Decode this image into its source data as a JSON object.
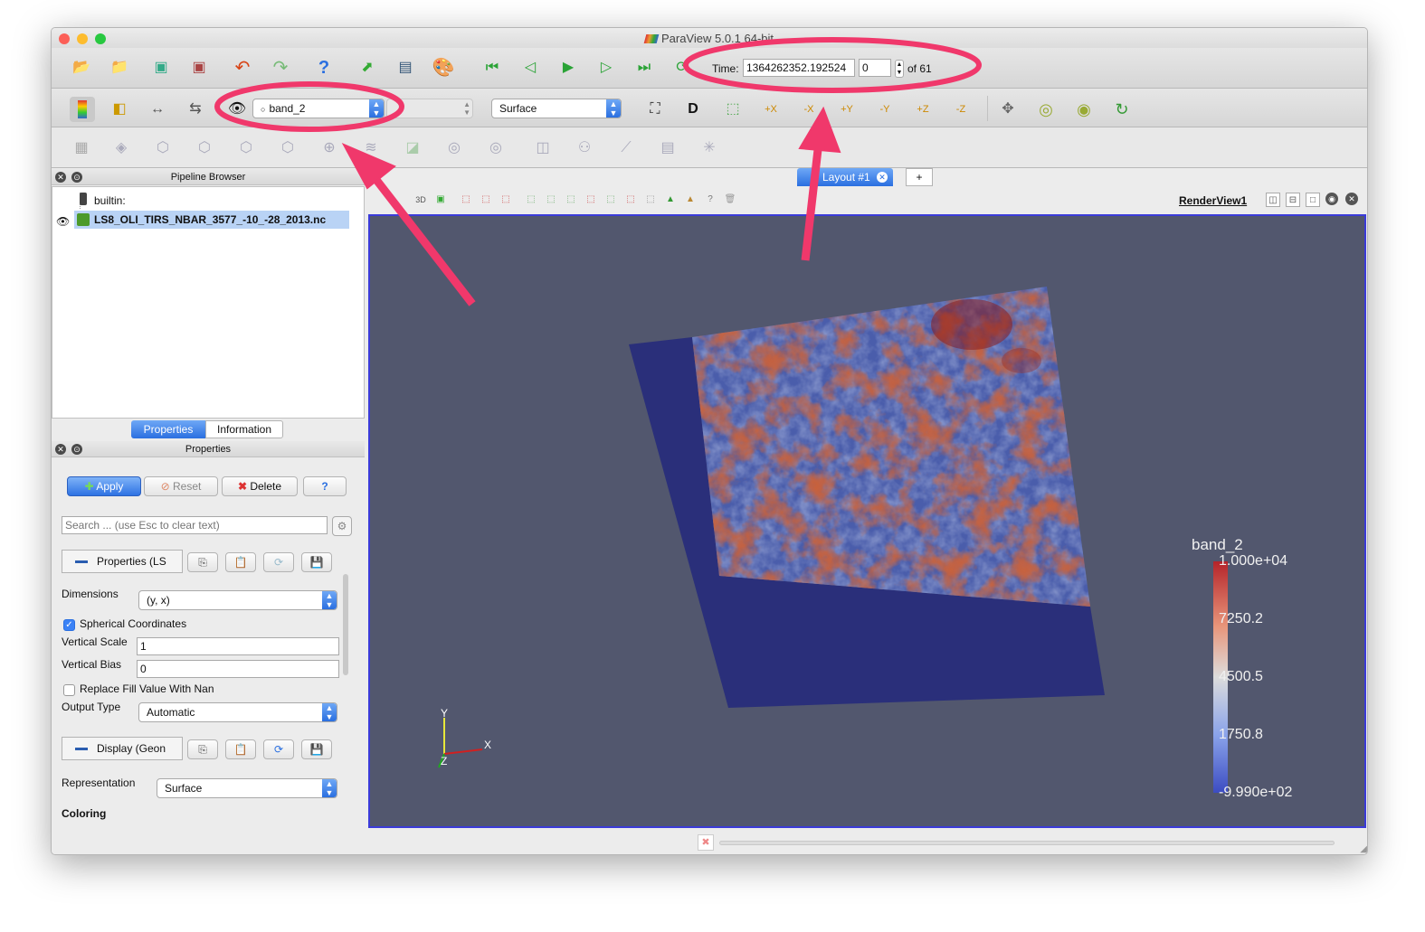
{
  "window": {
    "title": "ParaView 5.0.1 64-bit"
  },
  "toolbar": {
    "time_label": "Time:",
    "time_value": "1364262352.192524",
    "timestep_value": "0",
    "timestep_of": "of 61",
    "variable_combo": "band_2",
    "representation_combo": "Surface",
    "icons": [
      "open-icon",
      "load-state-icon",
      "save-data-icon",
      "save-state-icon",
      "undo-icon",
      "redo-icon",
      "help-icon",
      "connect-icon",
      "disconnect-icon",
      "color-palette-icon",
      "first-frame-icon",
      "previous-frame-icon",
      "play-icon",
      "next-frame-icon",
      "last-frame-icon",
      "loop-icon"
    ],
    "view_axis_labels": [
      "+X",
      "-X",
      "+Y",
      "-Y",
      "+Z",
      "-Z"
    ],
    "render_view_3d_label": "3D"
  },
  "tabs": {
    "layout_tab": "Layout #1",
    "add_tab": "+"
  },
  "view": {
    "name": "RenderView1"
  },
  "pipeline": {
    "header": "Pipeline Browser",
    "items": [
      {
        "label": "builtin:"
      },
      {
        "label": "LS8_OLI_TIRS_NBAR_3577_-10_-28_2013.nc"
      }
    ]
  },
  "panel_tabs": {
    "properties": "Properties",
    "information": "Information"
  },
  "properties": {
    "header": "Properties",
    "apply": "Apply",
    "reset": "Reset",
    "delete": "Delete",
    "help": "?",
    "search_placeholder": "Search ... (use Esc to clear text)",
    "section_properties": "Properties (LS",
    "section_display": "Display (Geon",
    "dimensions_label": "Dimensions",
    "dimensions_value": "(y, x)",
    "spherical_label": "Spherical Coordinates",
    "spherical_checked": true,
    "vscale_label": "Vertical Scale",
    "vscale_value": "1",
    "vbias_label": "Vertical Bias",
    "vbias_value": "0",
    "replace_fill_label": "Replace Fill Value With Nan",
    "replace_fill_checked": false,
    "output_type_label": "Output Type",
    "output_type_value": "Automatic",
    "representation_label": "Representation",
    "representation_value": "Surface",
    "coloring_label": "Coloring"
  },
  "colorbar": {
    "title": "band_2",
    "ticks": [
      "1.000e+04",
      "7250.2",
      "4500.5",
      "1750.8",
      "-9.990e+02"
    ],
    "colors": {
      "high": "#b4242a",
      "mid": "#dcdcdc",
      "low": "#3c4cc2"
    }
  },
  "axes": {
    "x": "X",
    "y": "Y",
    "z": "Z"
  },
  "colors": {
    "annotation": "#f0386b",
    "render_bg": "#52576e",
    "accent": "#3b82f6"
  }
}
